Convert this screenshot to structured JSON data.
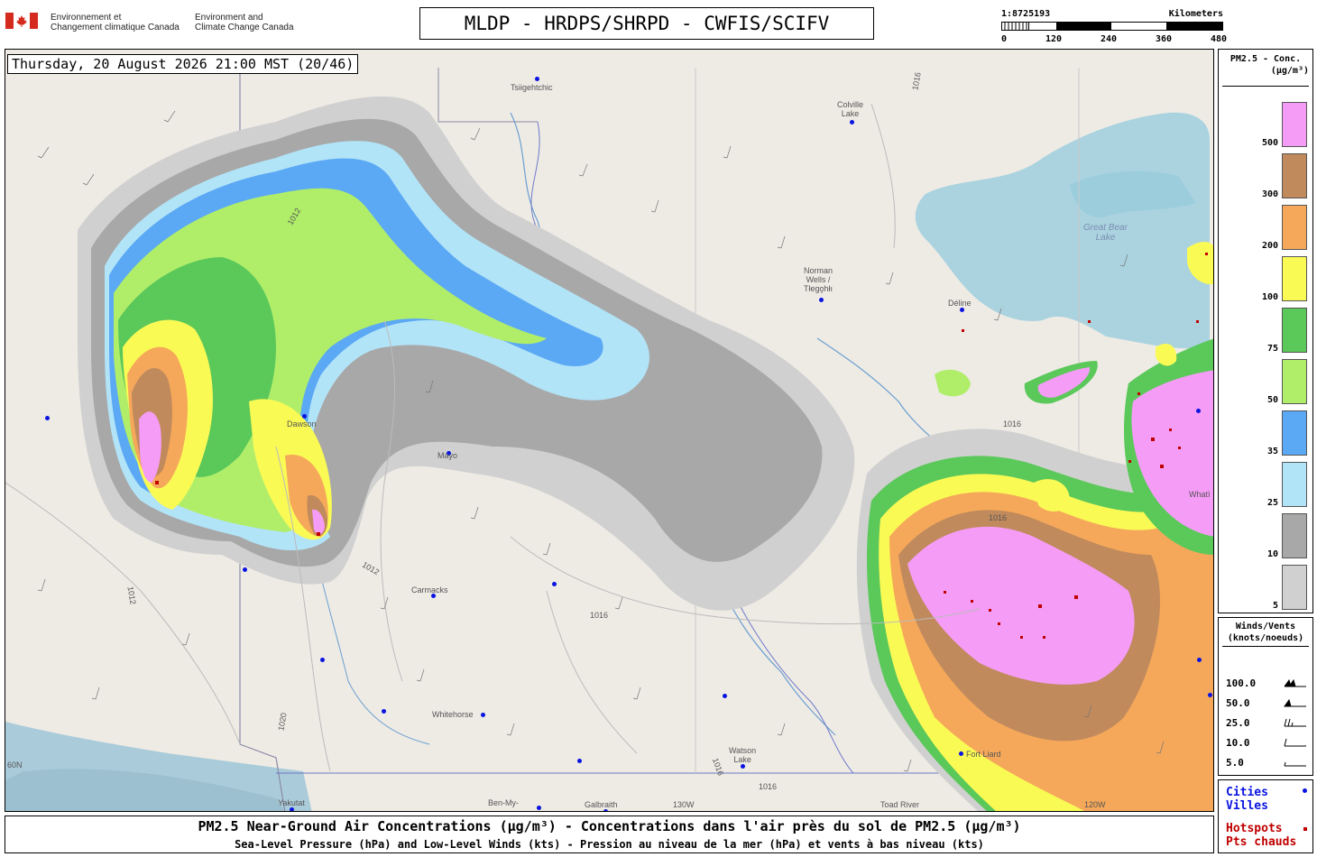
{
  "header": {
    "gov_fr_line1": "Environnement et",
    "gov_fr_line2": "Changement climatique Canada",
    "gov_en_line1": "Environment and",
    "gov_en_line2": "Climate Change Canada",
    "title": "MLDP - HRDPS/SHRPD - CWFIS/SCIFV"
  },
  "scale": {
    "ratio": "1:8725193",
    "units": "Kilometers",
    "ticks": [
      "0",
      "120",
      "240",
      "360",
      "480"
    ]
  },
  "map": {
    "timestamp": "Thursday, 20 August 2026 21:00 MST (20/46)",
    "places": {
      "tsiigehtchic": "Tsiigehtchic",
      "colville": "Colville",
      "colville_lake": "Lake",
      "great_bear": "Great Bear",
      "great_bear_lake": "Lake",
      "norman": "Norman",
      "norman_wells": "Wells /",
      "tlegohli": "Tłegǫhłı",
      "deline": "Déline",
      "dawson": "Dawson",
      "mayo": "Mayo",
      "carmacks": "Carmacks",
      "whitehorse": "Whitehorse",
      "watson": "Watson",
      "watson_lake": "Lake",
      "yakutat": "Yakutat",
      "ben_my": "Ben-My-",
      "galbraith": "Galbraith",
      "toad_river": "Toad River",
      "fort_liard": "Fort Liard",
      "whati": "Whatì",
      "meridian_130": "130W",
      "meridian_120": "120W",
      "lat_60": "60N"
    },
    "isobars": [
      "1012",
      "1012",
      "1012",
      "1016",
      "1016",
      "1016",
      "1016",
      "1020",
      "1016",
      "1016"
    ]
  },
  "legend": {
    "title_line1": "PM2.5 - Conc.",
    "title_line2": "(µg/m³)",
    "bins": [
      {
        "label": "500",
        "color": "#f59cf7"
      },
      {
        "label": "300",
        "color": "#c08a5c"
      },
      {
        "label": "200",
        "color": "#f5a85a"
      },
      {
        "label": "100",
        "color": "#fafa55"
      },
      {
        "label": "75",
        "color": "#5bc85a"
      },
      {
        "label": "50",
        "color": "#b0ee6a"
      },
      {
        "label": "35",
        "color": "#5ba8f5"
      },
      {
        "label": "25",
        "color": "#b2e4f8"
      },
      {
        "label": "10",
        "color": "#a8a8a8"
      },
      {
        "label": "5",
        "color": "#d0d0d0"
      }
    ]
  },
  "winds": {
    "title_line1": "Winds/Vents",
    "title_line2": "(knots/noeuds)",
    "rows": [
      "100.0",
      "50.0",
      "25.0",
      "10.0",
      "5.0"
    ]
  },
  "key": {
    "cities_line1": "Cities",
    "cities_line2": "Villes",
    "hotspots_line1": "Hotspots",
    "hotspots_line2": "Pts chauds",
    "cities_color": "#0a14e0",
    "hotspots_color": "#c00000"
  },
  "footer": {
    "line1": "PM2.5 Near-Ground Air Concentrations (µg/m³) - Concentrations dans l'air près du sol de PM2.5 (µg/m³)",
    "line2": "Sea-Level Pressure (hPa) and Low-Level Winds (kts) - Pression au niveau de la mer (hPa) et vents à bas niveau (kts)"
  }
}
